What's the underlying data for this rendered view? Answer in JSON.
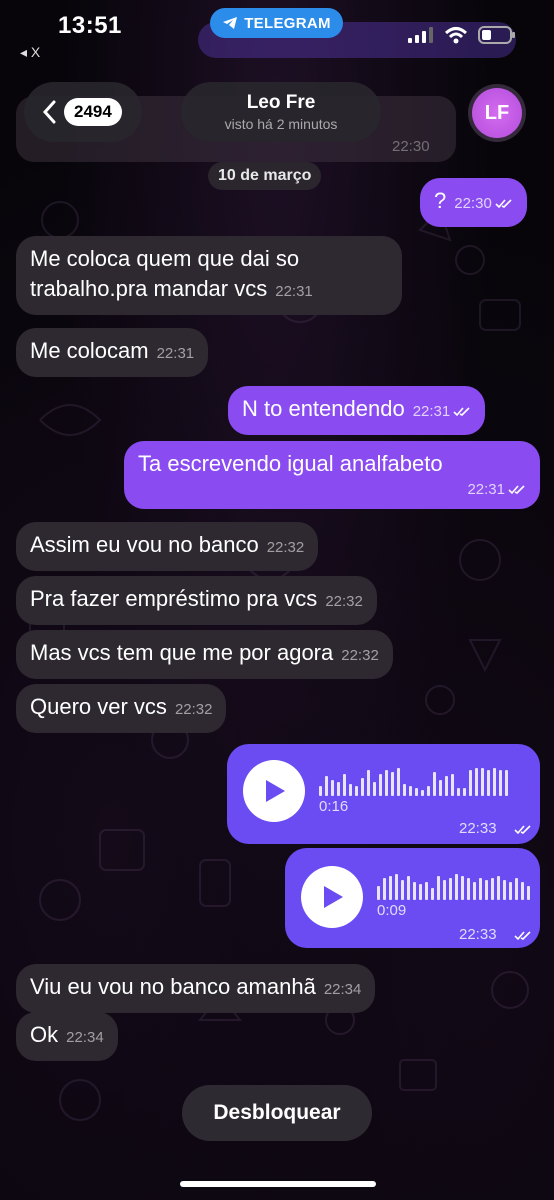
{
  "status_bar": {
    "time": "13:51",
    "back_app": "◂ X",
    "telegram_pill": "TELEGRAM"
  },
  "header": {
    "back_count": "2494",
    "contact_name": "Leo Fre",
    "last_seen": "visto há 2 minutos",
    "avatar_initials": "LF",
    "avatar_color": "#c35ee8"
  },
  "ghost": {
    "time": "22:30"
  },
  "date_separator": "10 de março",
  "messages": [
    {
      "dir": "out",
      "text": "?",
      "time": "22:30"
    },
    {
      "dir": "in",
      "text": "Me coloca quem que dai so trabalho.pra mandar vcs",
      "time": "22:31"
    },
    {
      "dir": "in",
      "text": "Me colocam",
      "time": "22:31"
    },
    {
      "dir": "out",
      "text": "N to entendendo",
      "time": "22:31"
    },
    {
      "dir": "out",
      "text": "Ta escrevendo igual analfabeto",
      "time": "22:31"
    },
    {
      "dir": "in",
      "text": "Assim eu vou no banco",
      "time": "22:32"
    },
    {
      "dir": "in",
      "text": "Pra fazer empréstimo pra vcs",
      "time": "22:32"
    },
    {
      "dir": "in",
      "text": "Mas vcs tem que  me por agora",
      "time": "22:32"
    },
    {
      "dir": "in",
      "text": "Quero ver vcs",
      "time": "22:32"
    },
    {
      "dir": "in",
      "text": "Viu eu vou no banco amanhã",
      "time": "22:34"
    },
    {
      "dir": "in",
      "text": "Ok",
      "time": "22:34"
    }
  ],
  "voice_messages": [
    {
      "duration": "0:16",
      "time": "22:33"
    },
    {
      "duration": "0:09",
      "time": "22:33"
    }
  ],
  "unblock_button": "Desbloquear",
  "colors": {
    "incoming_bubble": "#2e2830",
    "outgoing_bubble": "#8a4cf0",
    "voice_bubble": "#6a4cf2",
    "telegram_blue": "#2b8cea"
  }
}
